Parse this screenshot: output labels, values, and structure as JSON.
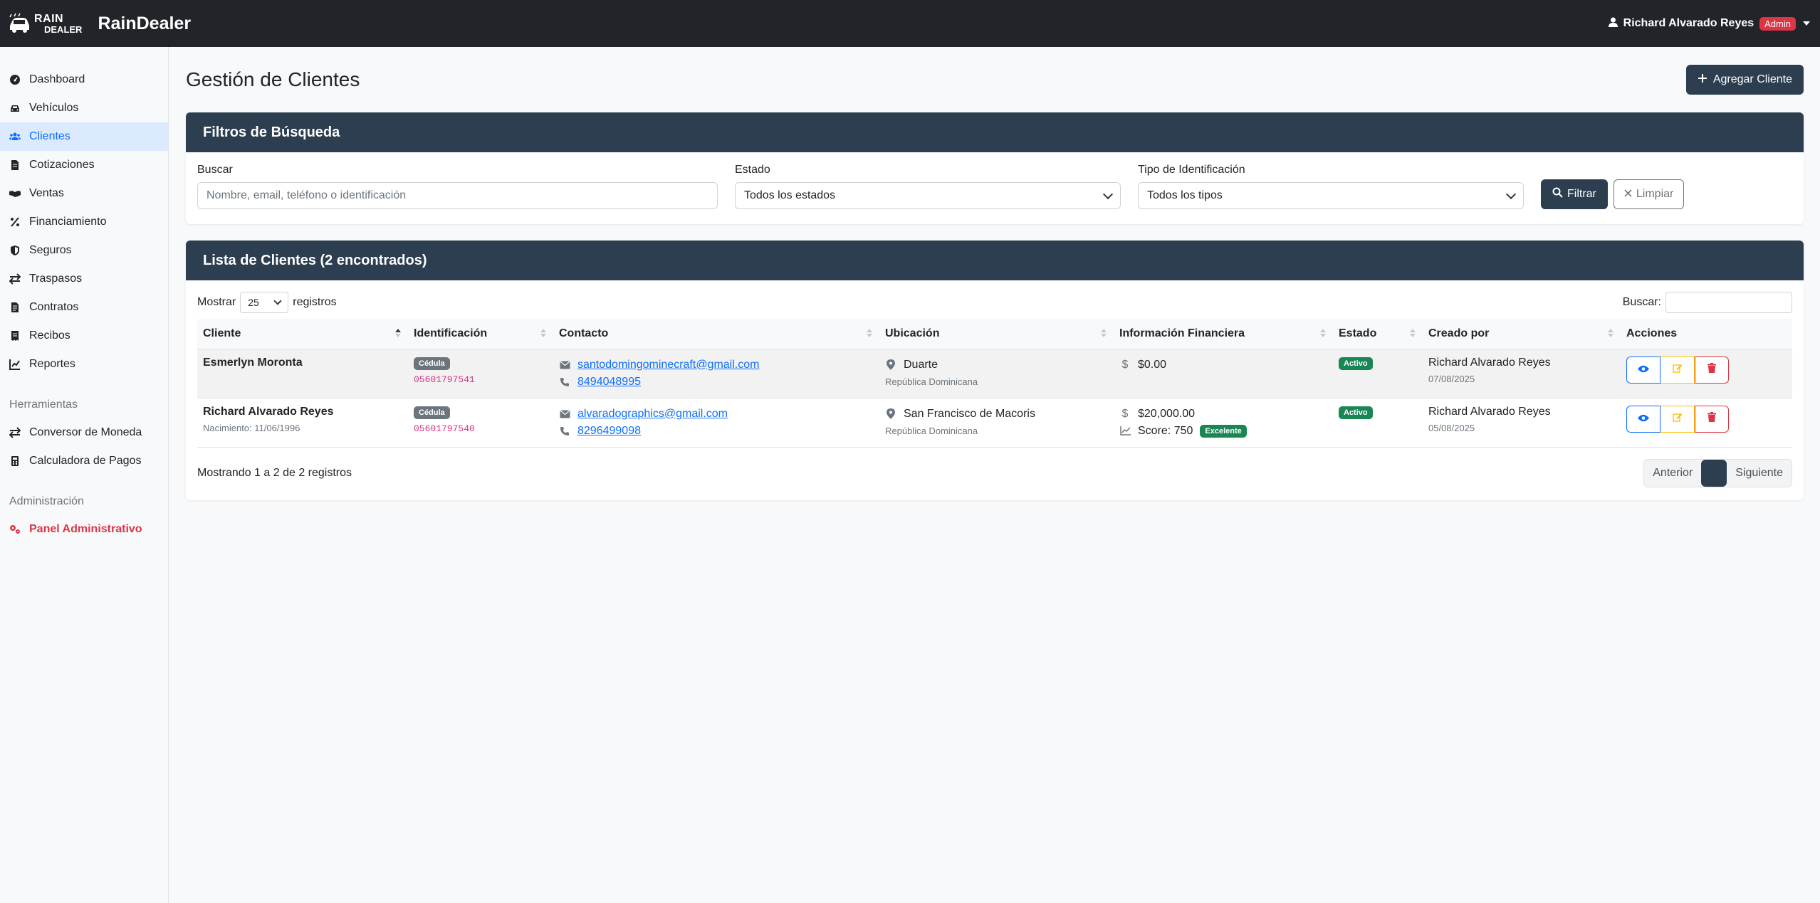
{
  "navbar": {
    "logo_line1": "RAIN",
    "logo_line2": "DEALER",
    "brand": "RainDealer",
    "user_name": "Richard Alvarado Reyes",
    "user_badge": "Admin"
  },
  "sidebar": {
    "items": [
      {
        "label": "Dashboard",
        "icon": "gauge-icon"
      },
      {
        "label": "Vehículos",
        "icon": "car-icon"
      },
      {
        "label": "Clientes",
        "icon": "users-icon",
        "active": true
      },
      {
        "label": "Cotizaciones",
        "icon": "invoice-icon"
      },
      {
        "label": "Ventas",
        "icon": "handshake-icon"
      },
      {
        "label": "Financiamiento",
        "icon": "percent-icon"
      },
      {
        "label": "Seguros",
        "icon": "shield-icon"
      },
      {
        "label": "Traspasos",
        "icon": "exchange-icon"
      },
      {
        "label": "Contratos",
        "icon": "contract-icon"
      },
      {
        "label": "Recibos",
        "icon": "receipt-icon"
      },
      {
        "label": "Reportes",
        "icon": "chart-icon"
      }
    ],
    "tools_heading": "Herramientas",
    "tools": [
      {
        "label": "Conversor de Moneda",
        "icon": "exchange-icon"
      },
      {
        "label": "Calculadora de Pagos",
        "icon": "calculator-icon"
      }
    ],
    "admin_heading": "Administración",
    "admin_item": {
      "label": "Panel Administrativo",
      "icon": "gears-icon"
    }
  },
  "page": {
    "title": "Gestión de Clientes",
    "add_button": "Agregar Cliente"
  },
  "filters": {
    "header": "Filtros de Búsqueda",
    "search_label": "Buscar",
    "search_placeholder": "Nombre, email, teléfono o identificación",
    "status_label": "Estado",
    "status_value": "Todos los estados",
    "idtype_label": "Tipo de Identificación",
    "idtype_value": "Todos los tipos",
    "filter_button": "Filtrar",
    "clear_button": "Limpiar"
  },
  "list": {
    "header": "Lista de Clientes (2 encontrados)",
    "show_label": "Mostrar",
    "page_size": "25",
    "records_label": "registros",
    "search_label": "Buscar:",
    "columns": [
      "Cliente",
      "Identificación",
      "Contacto",
      "Ubicación",
      "Información Financiera",
      "Estado",
      "Creado por",
      "Acciones"
    ],
    "rows": [
      {
        "name": "Esmerlyn Moronta",
        "sub": "",
        "id_type": "Cédula",
        "id_number": "05601797541",
        "email": "santodomingominecraft@gmail.com",
        "phone": "8494048995",
        "province": "Duarte",
        "country": "República Dominicana",
        "amount": "$0.00",
        "score": "",
        "score_badge": "",
        "status": "Activo",
        "created_by": "Richard Alvarado Reyes",
        "created_date": "07/08/2025"
      },
      {
        "name": "Richard Alvarado Reyes",
        "sub": "Nacimiento: 11/06/1996",
        "id_type": "Cédula",
        "id_number": "05601797540",
        "email": "alvaradographics@gmail.com",
        "phone": "8296499098",
        "province": "San Francisco de Macoris",
        "country": "República Dominicana",
        "amount": "$20,000.00",
        "score": "Score: 750",
        "score_badge": "Excelente",
        "status": "Activo",
        "created_by": "Richard Alvarado Reyes",
        "created_date": "05/08/2025"
      }
    ],
    "info": "Mostrando 1 a 2 de 2 registros",
    "prev": "Anterior",
    "current_page": "",
    "next": "Siguiente"
  }
}
